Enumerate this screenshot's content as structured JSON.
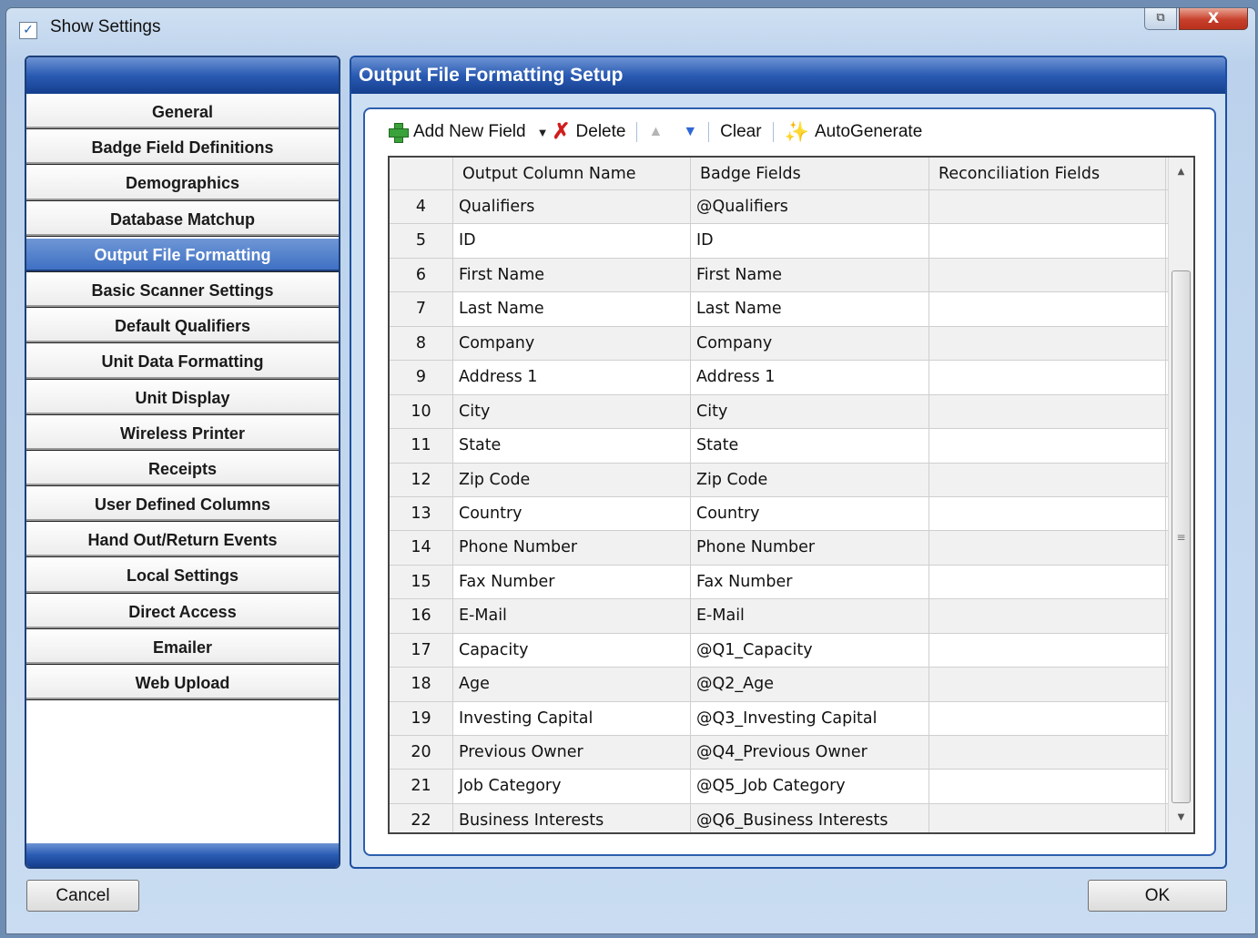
{
  "window": {
    "title": "Show Settings",
    "close_label": "X",
    "restore_label": "⧉"
  },
  "sidebar": {
    "items": [
      {
        "label": "General"
      },
      {
        "label": "Badge Field Definitions"
      },
      {
        "label": "Demographics"
      },
      {
        "label": "Database Matchup"
      },
      {
        "label": "Output File Formatting",
        "active": true
      },
      {
        "label": "Basic Scanner Settings"
      },
      {
        "label": "Default Qualifiers"
      },
      {
        "label": "Unit Data Formatting"
      },
      {
        "label": "Unit Display"
      },
      {
        "label": "Wireless Printer"
      },
      {
        "label": "Receipts"
      },
      {
        "label": "User Defined Columns"
      },
      {
        "label": "Hand Out/Return Events"
      },
      {
        "label": "Local Settings"
      },
      {
        "label": "Direct Access"
      },
      {
        "label": "Emailer"
      },
      {
        "label": "Web Upload"
      }
    ]
  },
  "panel": {
    "title": "Output File Formatting Setup"
  },
  "toolbar": {
    "add_label": "Add New Field",
    "delete_label": "Delete",
    "clear_label": "Clear",
    "autogenerate_label": "AutoGenerate",
    "icons": {
      "add": "plus-icon",
      "delete": "x-icon",
      "up": "arrow-up-icon",
      "down": "arrow-down-icon",
      "autogen": "wand-icon"
    }
  },
  "grid": {
    "columns": [
      "",
      "Output Column Name",
      "Badge Fields",
      "Reconciliation Fields"
    ],
    "rows": [
      [
        "4",
        "Qualifiers",
        "@Qualifiers",
        ""
      ],
      [
        "5",
        "ID",
        "ID",
        ""
      ],
      [
        "6",
        "First Name",
        "First Name",
        ""
      ],
      [
        "7",
        "Last Name",
        "Last Name",
        ""
      ],
      [
        "8",
        "Company",
        "Company",
        ""
      ],
      [
        "9",
        "Address 1",
        "Address 1",
        ""
      ],
      [
        "10",
        "City",
        "City",
        ""
      ],
      [
        "11",
        "State",
        "State",
        ""
      ],
      [
        "12",
        "Zip Code",
        "Zip Code",
        ""
      ],
      [
        "13",
        "Country",
        "Country",
        ""
      ],
      [
        "14",
        "Phone Number",
        "Phone Number",
        ""
      ],
      [
        "15",
        "Fax Number",
        "Fax Number",
        ""
      ],
      [
        "16",
        "E-Mail",
        "E-Mail",
        ""
      ],
      [
        "17",
        "Capacity",
        "@Q1_Capacity",
        ""
      ],
      [
        "18",
        "Age",
        "@Q2_Age",
        ""
      ],
      [
        "19",
        "Investing Capital",
        "@Q3_Investing Capital",
        ""
      ],
      [
        "20",
        "Previous Owner",
        "@Q4_Previous Owner",
        ""
      ],
      [
        "21",
        "Job Category",
        "@Q5_Job Category",
        ""
      ],
      [
        "22",
        "Business Interests",
        "@Q6_Business Interests",
        ""
      ]
    ]
  },
  "buttons": {
    "cancel": "Cancel",
    "ok": "OK"
  }
}
